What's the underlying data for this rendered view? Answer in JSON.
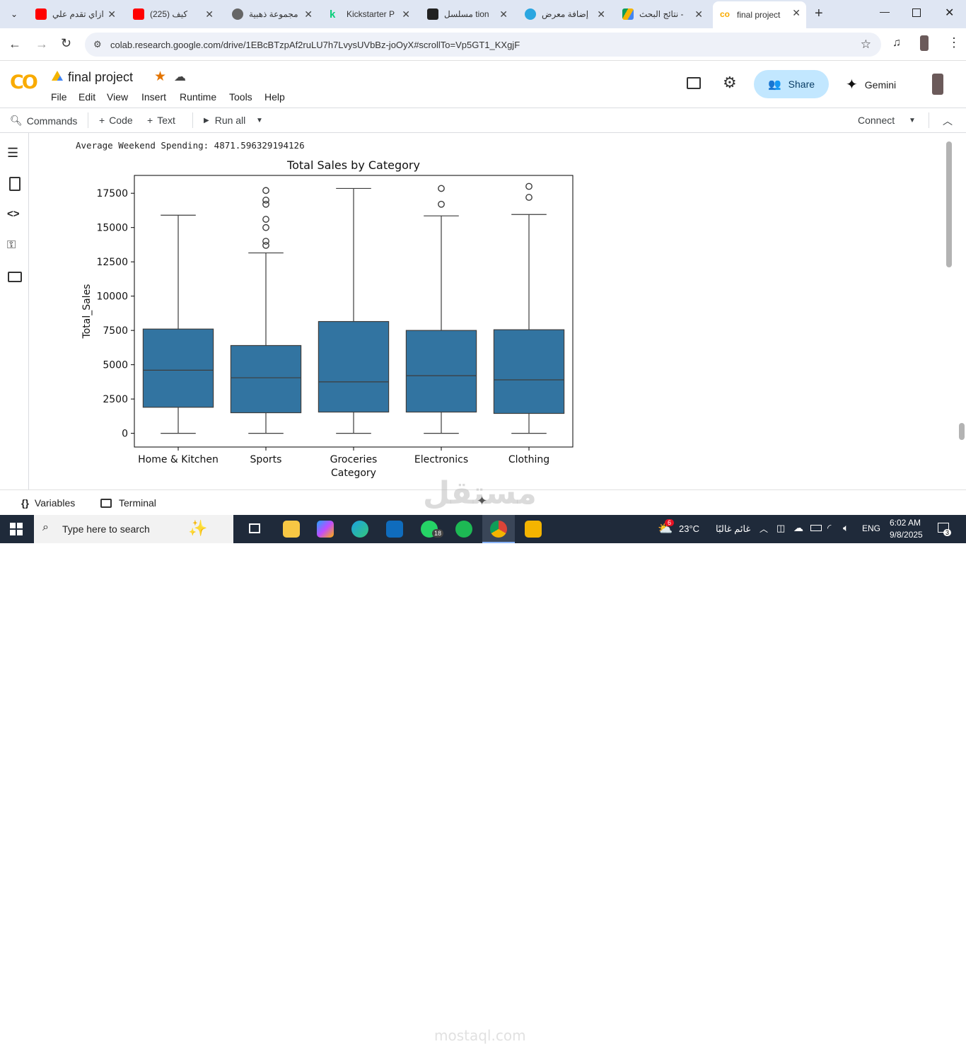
{
  "browser": {
    "tabs": [
      {
        "title": "ازاي تقدم علي",
        "color": "#ff0000"
      },
      {
        "title": "(225) كيف",
        "color": "#ff0000"
      },
      {
        "title": "مجموعة ذهبية",
        "color": "#555555"
      },
      {
        "title": "Kickstarter P",
        "color": "#05ce78"
      },
      {
        "title": "مسلسل tion",
        "color": "#222222"
      },
      {
        "title": "إضافة معرض",
        "color": "#2aa6e0"
      },
      {
        "title": "نتائج البحث -",
        "color": "#f4b400"
      },
      {
        "title": "final project",
        "color": "#f9ab00"
      }
    ],
    "new_tab_label": "+",
    "url": "colab.research.google.com/drive/1EBcBTzpAf2ruLU7h7LvysUVbBz-joOyX#scrollTo=Vp5GT1_KXgjF"
  },
  "colab": {
    "title": "final project",
    "menu": [
      "File",
      "Edit",
      "View",
      "Insert",
      "Runtime",
      "Tools",
      "Help"
    ],
    "share_label": "Share",
    "gemini_label": "Gemini",
    "commands_label": "Commands",
    "code_label": "Code",
    "text_label": "Text",
    "run_all_label": "Run all",
    "connect_label": "Connect",
    "output_line": "Average Weekend Spending: 4871.596329194126",
    "variables_label": "Variables",
    "terminal_label": "Terminal"
  },
  "chart_data": {
    "type": "box",
    "title": "Total Sales by Category",
    "xlabel": "Category",
    "ylabel": "Total_Sales",
    "ylim": [
      -1000,
      18800
    ],
    "yticks": [
      0,
      2500,
      5000,
      7500,
      10000,
      12500,
      15000,
      17500
    ],
    "ytick_labels": [
      "0",
      "2500",
      "5000",
      "7500",
      "10000",
      "12500",
      "15000",
      "17500"
    ],
    "color": "#3274a1",
    "categories": [
      "Home & Kitchen",
      "Sports",
      "Groceries",
      "Electronics",
      "Clothing"
    ],
    "boxes": [
      {
        "whisker_low": 0,
        "q1": 1900,
        "median": 4600,
        "q3": 7600,
        "whisker_high": 15900,
        "outliers": []
      },
      {
        "whisker_low": 0,
        "q1": 1500,
        "median": 4050,
        "q3": 6400,
        "whisker_high": 13150,
        "outliers": [
          13700,
          14000,
          15000,
          15600,
          16700,
          17000,
          17700
        ]
      },
      {
        "whisker_low": 0,
        "q1": 1550,
        "median": 3750,
        "q3": 8150,
        "whisker_high": 17850,
        "outliers": []
      },
      {
        "whisker_low": 0,
        "q1": 1550,
        "median": 4200,
        "q3": 7500,
        "whisker_high": 15850,
        "outliers": [
          16700,
          17850
        ]
      },
      {
        "whisker_low": 0,
        "q1": 1450,
        "median": 3900,
        "q3": 7550,
        "whisker_high": 15950,
        "outliers": [
          17200,
          18000
        ]
      }
    ]
  },
  "taskbar": {
    "search_placeholder": "Type here to search",
    "weather": "23°C",
    "weather_text": "غائم غالبًا",
    "language": "ENG",
    "time": "6:02 AM",
    "date": "9/8/2025",
    "whatsapp_badge": "18",
    "weather_badge": "6",
    "notif_count": "3"
  },
  "watermark": {
    "arabic": "مستقل",
    "latin": "mostaql.com"
  }
}
